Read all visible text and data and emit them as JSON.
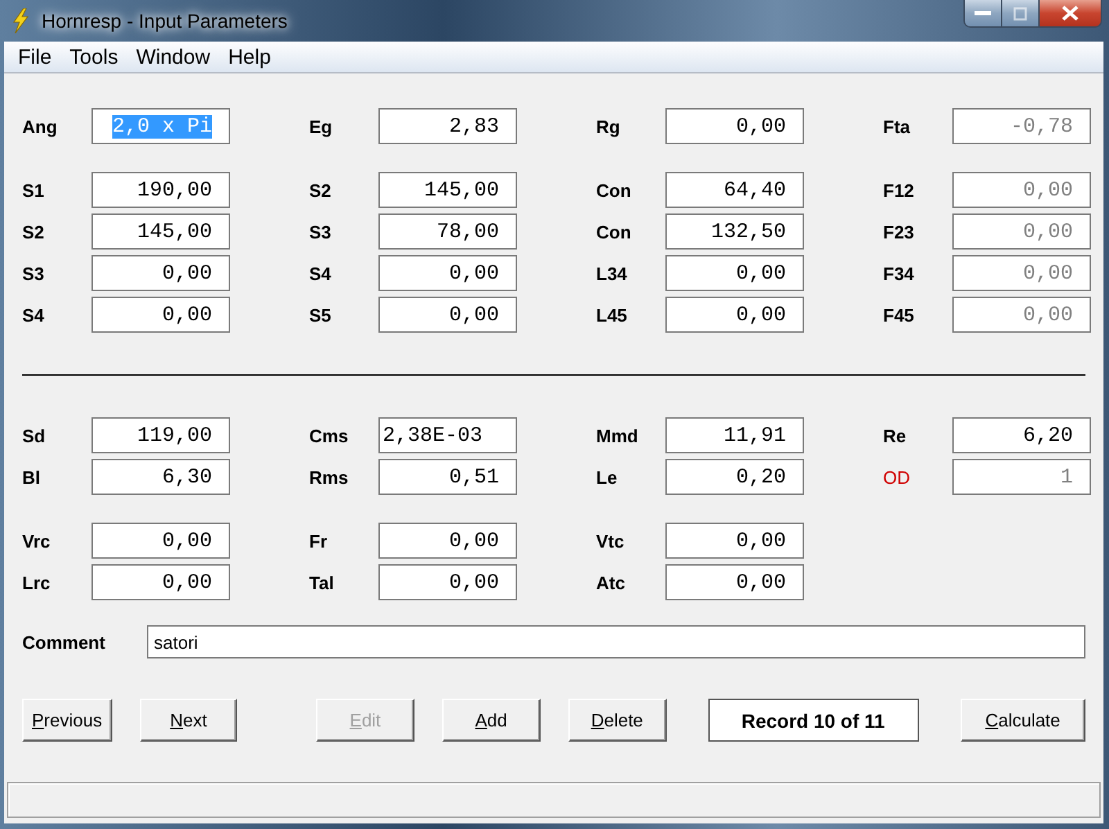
{
  "window": {
    "title": "Hornresp - Input Parameters"
  },
  "menu": [
    "File",
    "Tools",
    "Window",
    "Help"
  ],
  "sections": [
    {
      "rows": [
        [
          {
            "label": "Ang",
            "value": "2,0 x Pi",
            "selected": true,
            "disabled": false,
            "highlighted": false
          },
          {
            "label": "Eg",
            "value": "2,83",
            "selected": false,
            "disabled": false,
            "highlighted": false
          },
          {
            "label": "Rg",
            "value": "0,00",
            "selected": false,
            "disabled": false,
            "highlighted": false
          },
          {
            "label": "Fta",
            "value": "-0,78",
            "selected": false,
            "disabled": true,
            "highlighted": false
          }
        ]
      ]
    },
    {
      "rows": [
        [
          {
            "label": "S1",
            "value": "190,00",
            "selected": false,
            "disabled": false,
            "highlighted": false
          },
          {
            "label": "S2",
            "value": "145,00",
            "selected": false,
            "disabled": false,
            "highlighted": false
          },
          {
            "label": "Con",
            "value": "64,40",
            "selected": false,
            "disabled": false,
            "highlighted": false
          },
          {
            "label": "F12",
            "value": "0,00",
            "selected": false,
            "disabled": true,
            "highlighted": false
          }
        ],
        [
          {
            "label": "S2",
            "value": "145,00",
            "selected": false,
            "disabled": false,
            "highlighted": false
          },
          {
            "label": "S3",
            "value": "78,00",
            "selected": false,
            "disabled": false,
            "highlighted": false
          },
          {
            "label": "Con",
            "value": "132,50",
            "selected": false,
            "disabled": false,
            "highlighted": false
          },
          {
            "label": "F23",
            "value": "0,00",
            "selected": false,
            "disabled": true,
            "highlighted": false
          }
        ],
        [
          {
            "label": "S3",
            "value": "0,00",
            "selected": false,
            "disabled": false,
            "highlighted": false
          },
          {
            "label": "S4",
            "value": "0,00",
            "selected": false,
            "disabled": false,
            "highlighted": false
          },
          {
            "label": "L34",
            "value": "0,00",
            "selected": false,
            "disabled": false,
            "highlighted": false
          },
          {
            "label": "F34",
            "value": "0,00",
            "selected": false,
            "disabled": true,
            "highlighted": false
          }
        ],
        [
          {
            "label": "S4",
            "value": "0,00",
            "selected": false,
            "disabled": false,
            "highlighted": false
          },
          {
            "label": "S5",
            "value": "0,00",
            "selected": false,
            "disabled": false,
            "highlighted": false
          },
          {
            "label": "L45",
            "value": "0,00",
            "selected": false,
            "disabled": false,
            "highlighted": false
          },
          {
            "label": "F45",
            "value": "0,00",
            "selected": false,
            "disabled": true,
            "highlighted": false
          }
        ]
      ]
    },
    {
      "divider": true,
      "rows": [
        [
          {
            "label": "Sd",
            "value": "119,00",
            "selected": false,
            "disabled": false,
            "highlighted": false
          },
          {
            "label": "Cms",
            "value": "2,38E-03",
            "selected": false,
            "disabled": false,
            "highlighted": false,
            "left_aligned": true
          },
          {
            "label": "Mmd",
            "value": "11,91",
            "selected": false,
            "disabled": false,
            "highlighted": false
          },
          {
            "label": "Re",
            "value": "6,20",
            "selected": false,
            "disabled": false,
            "highlighted": false
          }
        ],
        [
          {
            "label": "Bl",
            "value": "6,30",
            "selected": false,
            "disabled": false,
            "highlighted": false
          },
          {
            "label": "Rms",
            "value": "0,51",
            "selected": false,
            "disabled": false,
            "highlighted": false
          },
          {
            "label": "Le",
            "value": "0,20",
            "selected": false,
            "disabled": false,
            "highlighted": false
          },
          {
            "label": "OD",
            "value": "1",
            "selected": false,
            "disabled": true,
            "highlighted": true
          }
        ]
      ]
    },
    {
      "rows": [
        [
          {
            "label": "Vrc",
            "value": "0,00",
            "selected": false,
            "disabled": false,
            "highlighted": false
          },
          {
            "label": "Fr",
            "value": "0,00",
            "selected": false,
            "disabled": false,
            "highlighted": false
          },
          {
            "label": "Vtc",
            "value": "0,00",
            "selected": false,
            "disabled": false,
            "highlighted": false
          }
        ],
        [
          {
            "label": "Lrc",
            "value": "0,00",
            "selected": false,
            "disabled": false,
            "highlighted": false
          },
          {
            "label": "Tal",
            "value": "0,00",
            "selected": false,
            "disabled": false,
            "highlighted": false
          },
          {
            "label": "Atc",
            "value": "0,00",
            "selected": false,
            "disabled": false,
            "highlighted": false
          }
        ]
      ]
    }
  ],
  "comment": {
    "label": "Comment",
    "value": "satori"
  },
  "buttons": [
    {
      "kind": "button",
      "underlined": "P",
      "rest": "revious",
      "disabled": false
    },
    {
      "kind": "button",
      "underlined": "N",
      "rest": "ext",
      "disabled": false
    },
    {
      "kind": "spacer"
    },
    {
      "kind": "button",
      "underlined": "E",
      "rest": "dit",
      "disabled": true
    },
    {
      "kind": "button",
      "underlined": "A",
      "rest": "dd",
      "disabled": false
    },
    {
      "kind": "button",
      "underlined": "D",
      "rest": "elete",
      "disabled": false
    },
    {
      "kind": "record",
      "text": "Record 10 of 11"
    },
    {
      "kind": "button",
      "underlined": "C",
      "rest": "alculate",
      "disabled": false
    }
  ]
}
